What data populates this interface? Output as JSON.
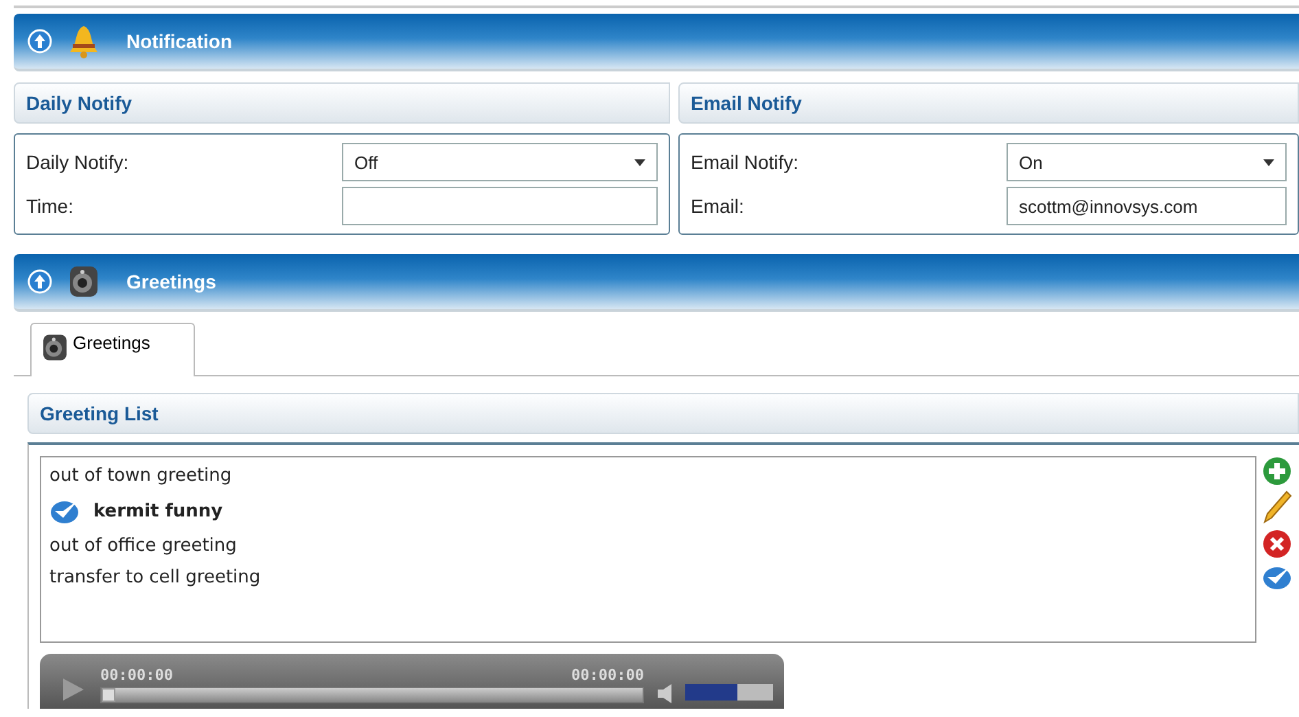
{
  "notification": {
    "title": "Notification",
    "daily": {
      "title": "Daily Notify",
      "fields": [
        {
          "kind": "select",
          "label": "Daily Notify:",
          "value": "Off"
        },
        {
          "kind": "text",
          "label": "Time:"
        }
      ]
    },
    "email": {
      "title": "Email Notify",
      "fields": [
        {
          "kind": "select",
          "label": "Email Notify:",
          "value": "On"
        },
        {
          "kind": "text",
          "label": "Email:",
          "value": "scottm@innovsys.com"
        }
      ]
    }
  },
  "greetings": {
    "title": "Greetings",
    "tabs": [
      {
        "label": "Greetings",
        "selected": true
      }
    ],
    "list_title": "Greeting List",
    "items": [
      {
        "label": "out of town greeting",
        "selected": false
      },
      {
        "label": "kermit funny",
        "selected": true
      },
      {
        "label": "out of office greeting",
        "selected": false
      },
      {
        "label": "transfer to cell greeting",
        "selected": false
      }
    ],
    "player": {
      "elapsed": "00:00:00",
      "duration": "00:00:00",
      "progress": {
        "level": 0
      },
      "volume": {
        "level": 0.6
      }
    }
  }
}
